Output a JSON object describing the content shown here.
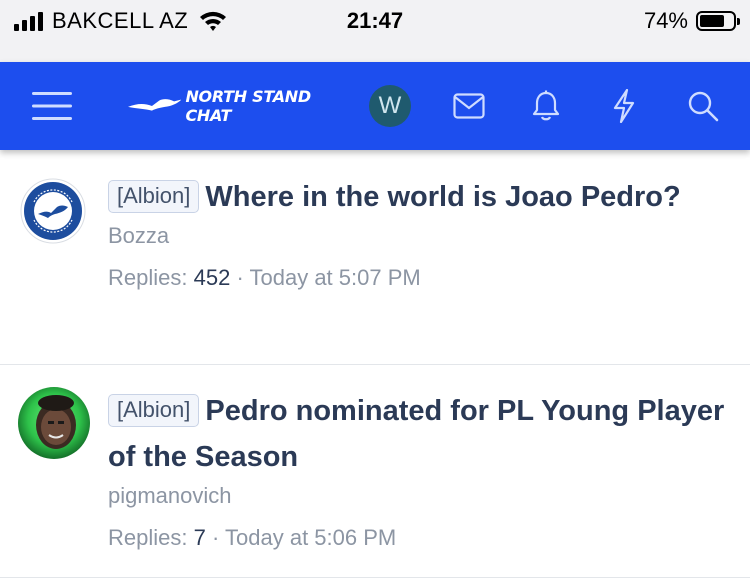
{
  "status_bar": {
    "carrier": "BAKCELL AZ",
    "time": "21:47",
    "battery_percent": "74%",
    "battery_level": 0.74
  },
  "navbar": {
    "logo_text": "NORTH STAND CHAT",
    "user_initial": "W",
    "icons": [
      "menu-icon",
      "envelope-icon",
      "bell-icon",
      "lightning-icon",
      "search-icon"
    ],
    "accent_color": "#1d4eee"
  },
  "threads": [
    {
      "prefix": "[Albion]",
      "title": "Where in the world is Joao Pedro?",
      "author": "Bozza",
      "replies_label": "Replies:",
      "replies": "452",
      "separator": "·",
      "timestamp": "Today at 5:07 PM"
    },
    {
      "prefix": "[Albion]",
      "title": "Pedro nominated for PL Young Player of the Season",
      "author": "pigmanovich",
      "replies_label": "Replies:",
      "replies": "7",
      "separator": "·",
      "timestamp": "Today at 5:06 PM"
    }
  ]
}
